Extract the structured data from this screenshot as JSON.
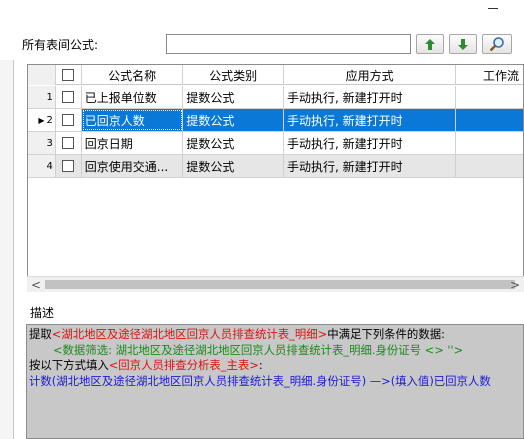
{
  "toolbar": {
    "label": "所有表间公式:",
    "search_value": "",
    "buttons": [
      {
        "name": "move-up-button",
        "icon": "up-arrow-icon",
        "color": "#2e8b2e"
      },
      {
        "name": "move-down-button",
        "icon": "down-arrow-icon",
        "color": "#2e8b2e"
      },
      {
        "name": "search-button",
        "icon": "magnifier-icon",
        "color": "#3a6ea5"
      }
    ]
  },
  "grid": {
    "columns": [
      "",
      "公式名称",
      "公式类别",
      "应用方式",
      "工作流"
    ],
    "rows": [
      {
        "num": "1",
        "name": "已上报单位数",
        "type": "提数公式",
        "app": "手动执行, 新建打开时"
      },
      {
        "num": "2",
        "name": "已回京人数",
        "type": "提数公式",
        "app": "手动执行, 新建打开时"
      },
      {
        "num": "3",
        "name": "回京日期",
        "type": "提数公式",
        "app": "手动执行, 新建打开时"
      },
      {
        "num": "4",
        "name": "回京使用交通...",
        "type": "提数公式",
        "app": "手动执行, 新建打开时"
      }
    ],
    "selected_index": 1,
    "selection_color": "#0a78d7"
  },
  "description": {
    "label": "描述",
    "l1_prefix": "提取",
    "l1_table": "<湖北地区及途径湖北地区回京人员排查统计表_明细>",
    "l1_suffix": "中满足下列条件的数据:",
    "l2_filter": "<数据筛选: 湖北地区及途径湖北地区回京人员排查统计表_明细.身份证号 <> ''>",
    "l3_prefix": "按以下方式填入",
    "l3_target": "<回京人员排查分析表_主表>",
    "l3_suffix": ":",
    "l4_expr": "计数(湖北地区及途径湖北地区回京人员排查统计表_明细.身份证号)  —>(填入值)已回京人数"
  }
}
